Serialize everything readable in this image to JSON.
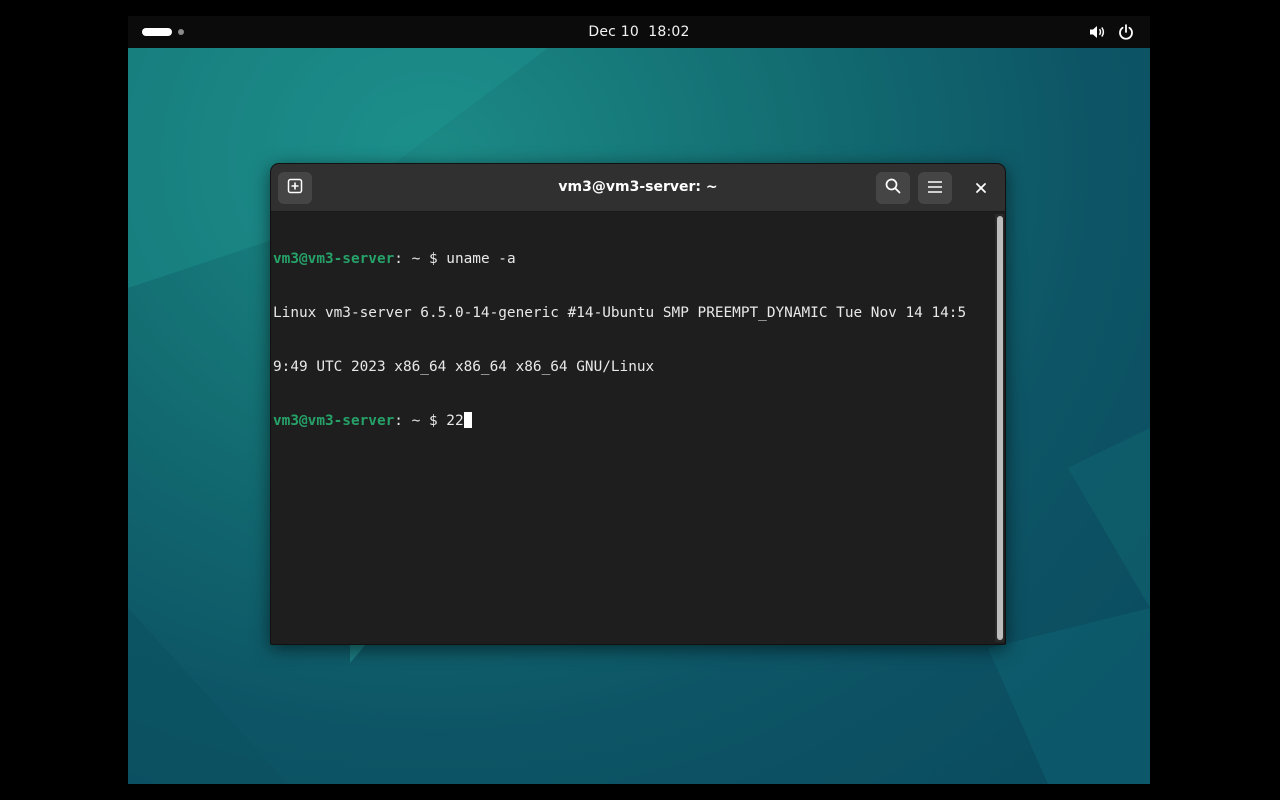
{
  "topbar": {
    "clock": "Dec 10  18:02",
    "workspaces": [
      "active",
      "inactive"
    ],
    "icons": [
      "volume-icon",
      "power-icon"
    ]
  },
  "window": {
    "title": "vm3@vm3-server: ~",
    "buttons": [
      "new-tab-icon",
      "search-icon",
      "hamburger-menu-icon",
      "close-icon"
    ]
  },
  "terminal": {
    "lines": [
      {
        "user": "vm3@vm3-server",
        "sep": ": ",
        "dir": "~",
        "sym": "$ ",
        "cmd": "uname -a"
      },
      {
        "text": "Linux vm3-server 6.5.0-14-generic #14-Ubuntu SMP PREEMPT_DYNAMIC Tue Nov 14 14:5"
      },
      {
        "text": "9:49 UTC 2023 x86_64 x86_64 x86_64 GNU/Linux"
      },
      {
        "user": "vm3@vm3-server",
        "sep": ": ",
        "dir": "~",
        "sym": "$ ",
        "cmd": "22"
      }
    ]
  },
  "colors": {
    "prompt": "#26a269",
    "terminal_bg": "#1e1e1e",
    "headerbar": "#303030",
    "desktop": "#136e72"
  }
}
